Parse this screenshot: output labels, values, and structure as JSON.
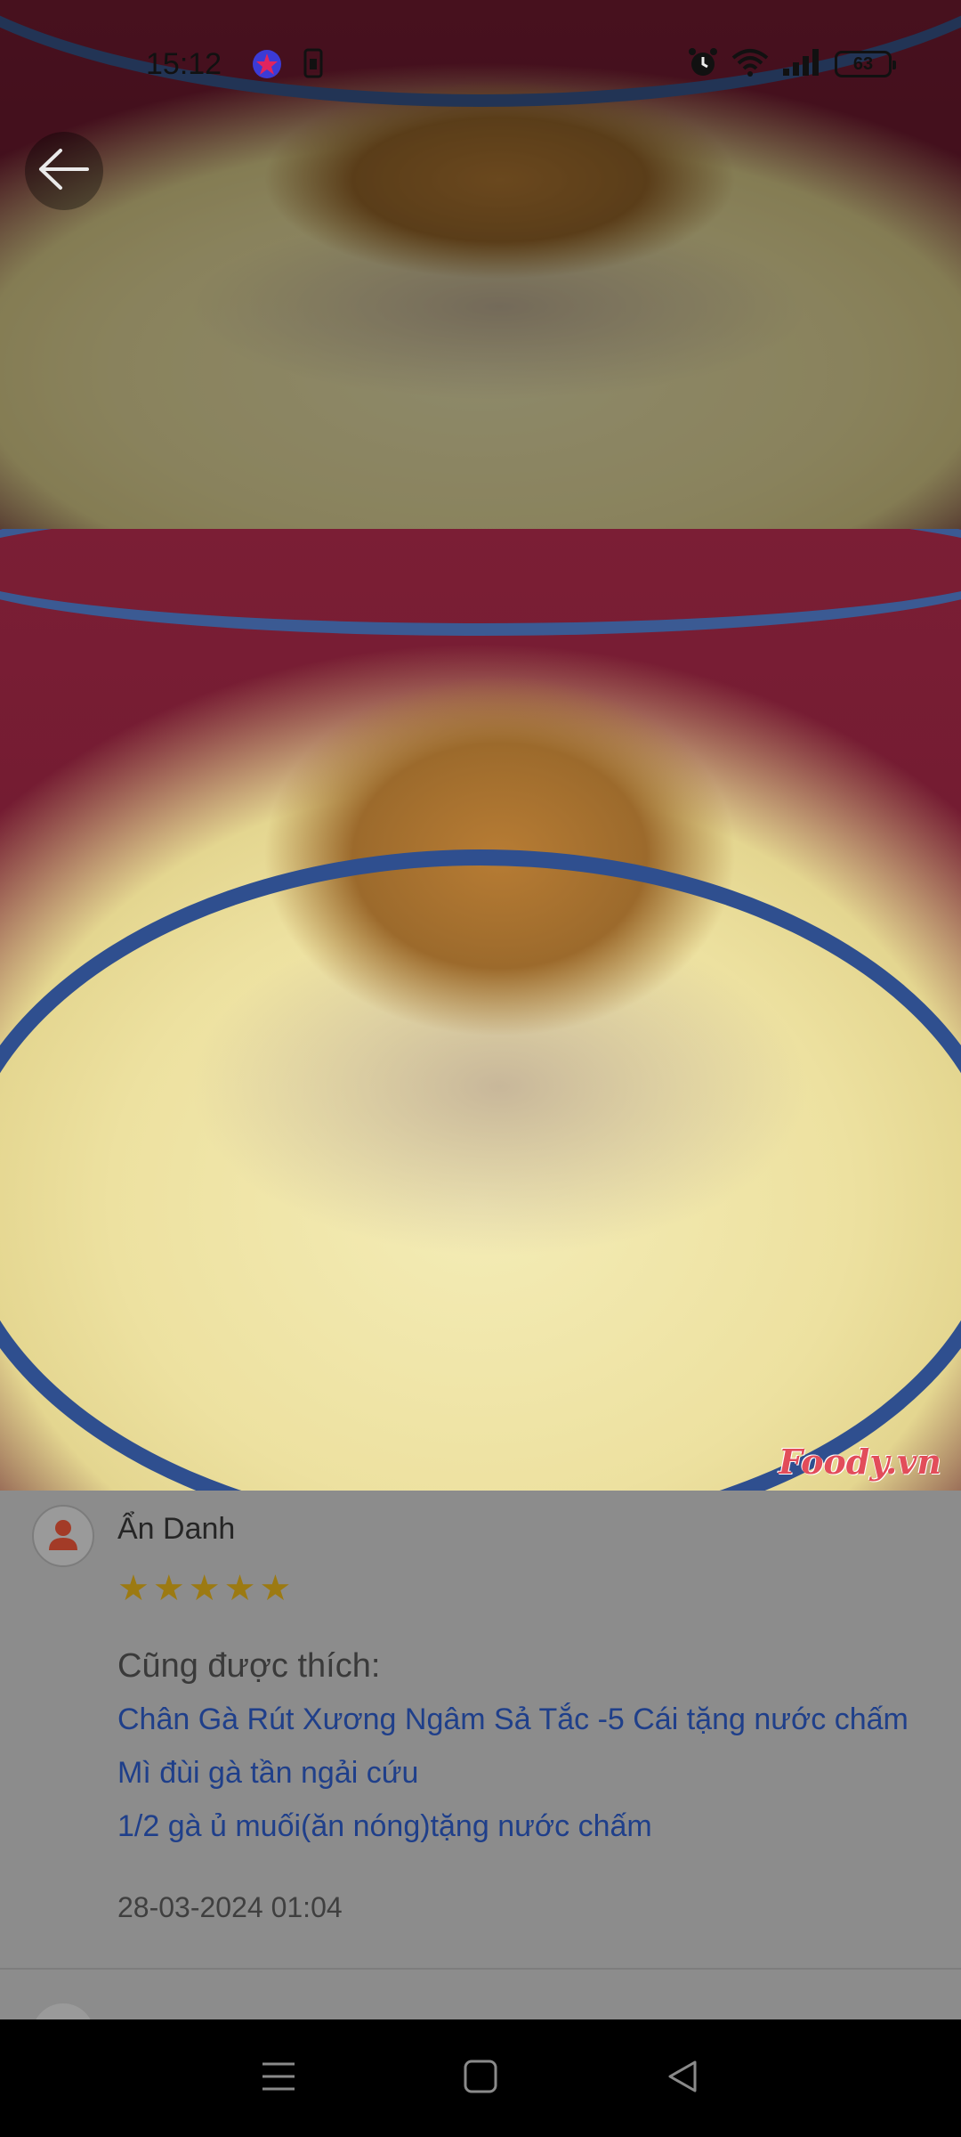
{
  "status_bar": {
    "time": "15:12",
    "battery": "63",
    "icons": [
      "app-notification-icon",
      "sim-icon",
      "alarm-icon",
      "wifi-icon",
      "signal-icon",
      "battery-icon"
    ]
  },
  "photo": {
    "watermark": "Foody.vn"
  },
  "review": {
    "reviewer_name": "Ẩn Danh",
    "rating": 5,
    "stars": [
      "★",
      "★",
      "★",
      "★",
      "★"
    ],
    "also_liked_label": "Cũng được thích:",
    "also_liked_items": [
      "Chân Gà Rút Xương Ngâm Sả Tắc -5 Cái tặng nước chấm",
      "Mì đùi gà tần ngải cứu",
      "1/2 gà ủ muối(ăn nóng)tặng nước chấm"
    ],
    "timestamp": "28-03-2024 01:04"
  },
  "colors": {
    "link": "#1f3f8a",
    "star": "#9c7a12",
    "overlay": "#8c8c8c"
  }
}
